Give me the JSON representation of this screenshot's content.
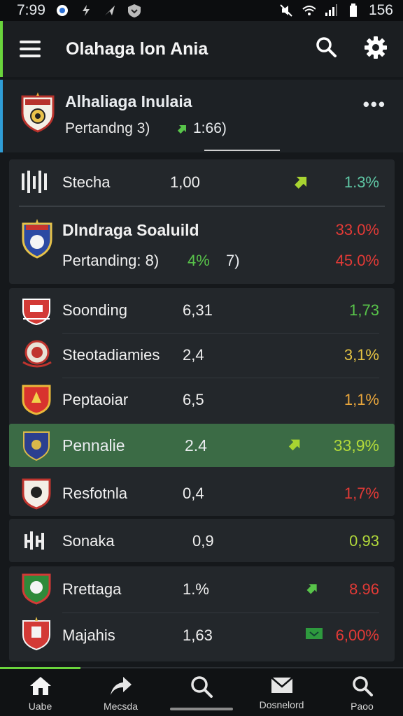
{
  "status": {
    "time": "7:99",
    "battery": "156",
    "icons": [
      "vpn-icon",
      "bolt-icon",
      "send-icon",
      "shield-icon",
      "mute-icon",
      "wifi-icon",
      "signal-icon",
      "battery-icon"
    ]
  },
  "appbar": {
    "title": "Olahaga lon Ania",
    "icons": [
      "menu-icon",
      "search-icon",
      "gear-icon"
    ]
  },
  "featured": {
    "name": "Alhaliaga Inulaia",
    "subtitle": "Pertandng 3)",
    "stat": "1:66)",
    "more": "•••"
  },
  "rows": [
    {
      "name": "Stecha",
      "v1": "1,00",
      "v2": "1.3%",
      "v2_color": "teal",
      "icon": "up-arrow-icon"
    },
    {
      "name": "Dlndraga Soaluild",
      "sub": "Pertanding: 8)",
      "pct": "4%",
      "pct2": "7)",
      "v2a": "33.0%",
      "v2b": "45.0%"
    },
    {
      "name": "Soonding",
      "v1": "6,31",
      "v2": "1,73"
    },
    {
      "name": "Steotadiamies",
      "v1": "2,4",
      "v2": "3,1%"
    },
    {
      "name": "Peptaoiar",
      "v1": "6,5",
      "v2": "1,1%"
    },
    {
      "name": "Pennalie",
      "v1": "2.4",
      "v2": "33,9%"
    },
    {
      "name": "Resfotnla",
      "v1": "0,4",
      "v2": "1,7%"
    },
    {
      "name": "Sonaka",
      "v1": "0,9",
      "v2": "0,93"
    },
    {
      "name": "Rrettaga",
      "v1": "1.%",
      "v2": "8.96"
    },
    {
      "name": "Majahis",
      "v1": "1,63",
      "v2": "6,00%"
    }
  ],
  "nav": [
    {
      "label": "Uabe",
      "icon": "home-icon"
    },
    {
      "label": "Mecsda",
      "icon": "share-icon"
    },
    {
      "label": "",
      "icon": "search-icon"
    },
    {
      "label": "Dosnelord",
      "icon": "mail-icon"
    },
    {
      "label": "Paoo",
      "icon": "search-icon"
    }
  ],
  "colors": {
    "accent": "#6ad43c",
    "highlight": "#3b6b45",
    "red": "#e23a36",
    "green": "#58c44a"
  }
}
